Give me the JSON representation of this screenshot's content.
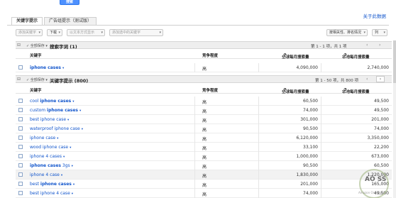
{
  "top_button": {
    "label": "搜索"
  },
  "help_link": "关于此数据",
  "tabs": [
    {
      "label": "关键字提示"
    },
    {
      "label": "广告组提示（测试版）"
    }
  ],
  "toolbar": {
    "add_keyword": "添加关键字",
    "download": "下载",
    "search_trends": "以文本方式显示",
    "more_like": "添加选中的关键字",
    "sort": "按相关性、排名情况",
    "columns": "列"
  },
  "search_terms_section": {
    "title": "搜索字词 (1)",
    "download_label": "全部保存",
    "page_info": "第 1 - 1 项，共 1 项",
    "columns": {
      "keyword": "关键字",
      "competition": "竞争程度",
      "global": "全球每月搜索量",
      "local": "本地每月搜索量"
    },
    "rows": [
      {
        "keyword": "iphone cases",
        "competition": "高",
        "global": "4,090,000",
        "local": "2,740,000"
      }
    ]
  },
  "ideas_section": {
    "title": "关键字提示 (800)",
    "download_label": "全部保存",
    "page_info": "第 1 - 50 项，共 800 项",
    "columns": {
      "keyword": "关键字",
      "competition": "竞争程度",
      "global": "全球每月搜索量",
      "local": "本地每月搜索量"
    },
    "rows": [
      {
        "pre": "cool ",
        "bold": "iphone cases",
        "post": "",
        "competition": "高",
        "global": "60,500",
        "local": "49,500",
        "shade": false
      },
      {
        "pre": "custom ",
        "bold": "iphone cases",
        "post": "",
        "competition": "高",
        "global": "74,000",
        "local": "49,500",
        "shade": false
      },
      {
        "pre": "best iphone case",
        "bold": "",
        "post": "",
        "competition": "高",
        "global": "301,000",
        "local": "201,000",
        "shade": false
      },
      {
        "pre": "waterproof iphone case",
        "bold": "",
        "post": "",
        "competition": "高",
        "global": "90,500",
        "local": "74,000",
        "shade": false
      },
      {
        "pre": "iphone case",
        "bold": "",
        "post": "",
        "competition": "高",
        "global": "6,120,000",
        "local": "3,350,000",
        "shade": false
      },
      {
        "pre": "wood iphone case",
        "bold": "",
        "post": "",
        "competition": "高",
        "global": "33,100",
        "local": "22,200",
        "shade": false
      },
      {
        "pre": "iphone 4 cases",
        "bold": "",
        "post": "",
        "competition": "高",
        "global": "1,000,000",
        "local": "673,000",
        "shade": false
      },
      {
        "pre": "",
        "bold": "iphone cases",
        "post": " 3gs",
        "competition": "高",
        "global": "90,500",
        "local": "60,500",
        "shade": false
      },
      {
        "pre": "iphone 4 case",
        "bold": "",
        "post": "",
        "competition": "高",
        "global": "1,830,000",
        "local": "1,220,000",
        "shade": true
      },
      {
        "pre": "best ",
        "bold": "iphone cases",
        "post": "",
        "competition": "高",
        "global": "201,000",
        "local": "165,000",
        "shade": false
      },
      {
        "pre": "best iphone 4 case",
        "bold": "",
        "post": "",
        "competition": "高",
        "global": "74,000",
        "local": "49,500",
        "shade": false
      }
    ]
  },
  "watermark": {
    "text": "AO SS",
    "subtext": "Amazon One-Stop"
  }
}
